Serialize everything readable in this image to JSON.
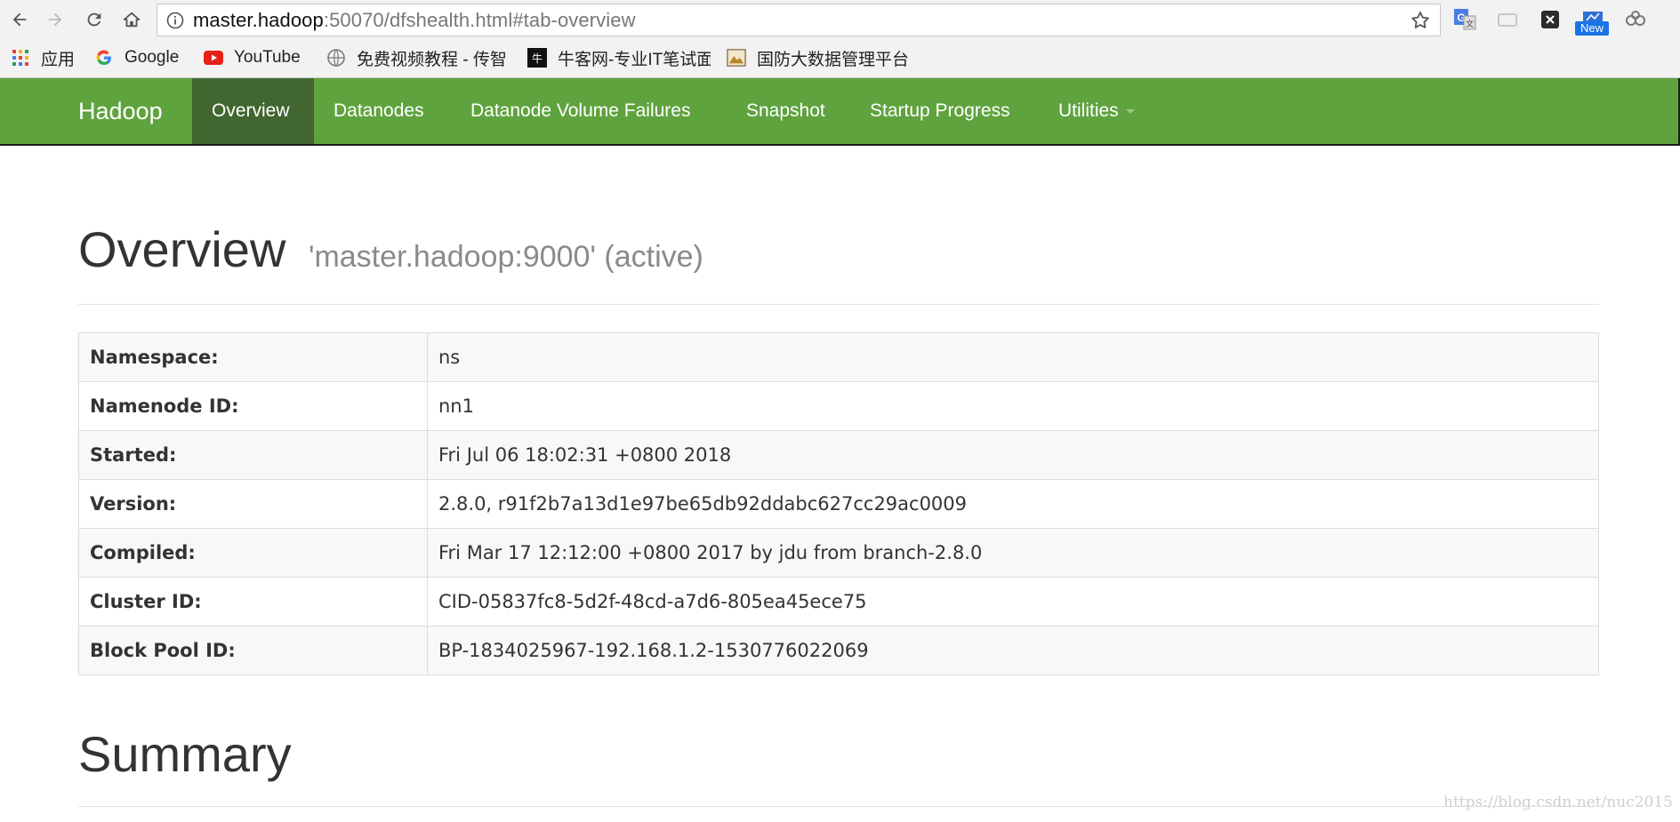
{
  "browser": {
    "url_host": "master.hadoop",
    "url_path": ":50070/dfshealth.html#tab-overview",
    "extension_new_badge": "New"
  },
  "bookmarks": [
    {
      "label": "应用",
      "icon": "apps-grid-icon"
    },
    {
      "label": "Google",
      "icon": "google-g-icon"
    },
    {
      "label": "YouTube",
      "icon": "youtube-icon"
    },
    {
      "label": "免费视频教程 - 传智",
      "icon": "site-globe-icon"
    },
    {
      "label": "牛客网-专业IT笔试面",
      "icon": "nowcoder-icon"
    },
    {
      "label": "国防大数据管理平台",
      "icon": "bookmark-image-icon"
    }
  ],
  "navbar": {
    "brand": "Hadoop",
    "items": [
      {
        "label": "Overview",
        "active": true
      },
      {
        "label": "Datanodes"
      },
      {
        "label": "Datanode Volume Failures"
      },
      {
        "label": "Snapshot"
      },
      {
        "label": "Startup Progress"
      },
      {
        "label": "Utilities",
        "dropdown": true
      }
    ]
  },
  "overview": {
    "title": "Overview",
    "subtitle": "'master.hadoop:9000' (active)",
    "rows": [
      {
        "label": "Namespace:",
        "value": "ns"
      },
      {
        "label": "Namenode ID:",
        "value": "nn1"
      },
      {
        "label": "Started:",
        "value": "Fri Jul 06 18:02:31 +0800 2018"
      },
      {
        "label": "Version:",
        "value": "2.8.0, r91f2b7a13d1e97be65db92ddabc627cc29ac0009"
      },
      {
        "label": "Compiled:",
        "value": "Fri Mar 17 12:12:00 +0800 2017 by jdu from branch-2.8.0"
      },
      {
        "label": "Cluster ID:",
        "value": "CID-05837fc8-5d2f-48cd-a7d6-805ea45ece75"
      },
      {
        "label": "Block Pool ID:",
        "value": "BP-1834025967-192.168.1.2-1530776022069"
      }
    ]
  },
  "summary": {
    "title": "Summary"
  },
  "watermark": "https://blog.csdn.net/nuc2015",
  "colors": {
    "navbar": "#5fa33e",
    "navbar_active": "#42662f",
    "text": "#333333",
    "muted": "#8a8a8a"
  }
}
